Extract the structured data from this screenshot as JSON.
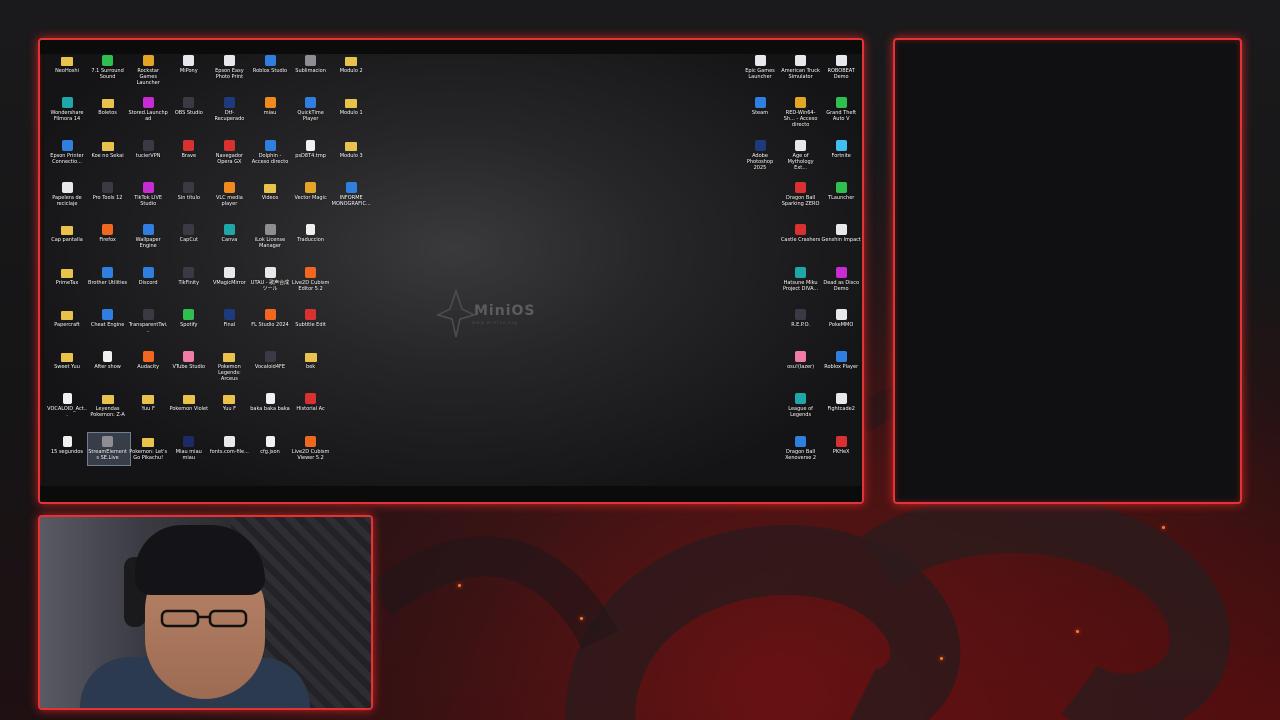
{
  "desktop": {
    "logo": {
      "name": "MiniOS",
      "tagline": "www.minios.org"
    },
    "left_icons": [
      {
        "label": "NeoHoshi",
        "kind": "folder",
        "col": 0,
        "row": 0
      },
      {
        "label": "7.1 Surround Sound",
        "kind": "app-green",
        "col": 1,
        "row": 0
      },
      {
        "label": "Rockstar Games Launcher",
        "kind": "app-yellow",
        "col": 2,
        "row": 0
      },
      {
        "label": "MiPony",
        "kind": "app-white",
        "col": 3,
        "row": 0
      },
      {
        "label": "Epson Easy Photo Print",
        "kind": "app-white",
        "col": 4,
        "row": 0
      },
      {
        "label": "Roblox Studio",
        "kind": "app-blue",
        "col": 5,
        "row": 0
      },
      {
        "label": "Sublimacion",
        "kind": "app-gray",
        "col": 6,
        "row": 0
      },
      {
        "label": "Modulo 2",
        "kind": "folder",
        "col": 7,
        "row": 0
      },
      {
        "label": "Wondershare Filmora 14",
        "kind": "app-teal",
        "col": 0,
        "row": 1
      },
      {
        "label": "Boletos",
        "kind": "folder",
        "col": 1,
        "row": 1
      },
      {
        "label": "Stored.Launchpad",
        "kind": "app-magenta",
        "col": 2,
        "row": 1
      },
      {
        "label": "OBS Studio",
        "kind": "app-dark",
        "col": 3,
        "row": 1
      },
      {
        "label": "Dtf- Recuperado",
        "kind": "app-ps",
        "col": 4,
        "row": 1
      },
      {
        "label": "miau",
        "kind": "app-vlc",
        "col": 5,
        "row": 1
      },
      {
        "label": "QuickTime Player",
        "kind": "app-blue",
        "col": 6,
        "row": 1
      },
      {
        "label": "Modulo 1",
        "kind": "folder",
        "col": 7,
        "row": 1
      },
      {
        "label": "Epson Printer Connectio...",
        "kind": "app-blue",
        "col": 0,
        "row": 2
      },
      {
        "label": "Koe no Sekai",
        "kind": "folder",
        "col": 1,
        "row": 2
      },
      {
        "label": "tucierVPN",
        "kind": "app-dark",
        "col": 2,
        "row": 2
      },
      {
        "label": "Brave",
        "kind": "app-red",
        "col": 3,
        "row": 2
      },
      {
        "label": "Navegador Opera GX",
        "kind": "app-red",
        "col": 4,
        "row": 2
      },
      {
        "label": "Dolphin - Acceso directo",
        "kind": "app-blue",
        "col": 5,
        "row": 2
      },
      {
        "label": "psD8T4.tmp",
        "kind": "file",
        "col": 6,
        "row": 2
      },
      {
        "label": "Modulo 3",
        "kind": "folder",
        "col": 7,
        "row": 2
      },
      {
        "label": "Papelera de reciclaje",
        "kind": "app-white",
        "col": 0,
        "row": 3
      },
      {
        "label": "Pro Tools 12",
        "kind": "app-dark",
        "col": 1,
        "row": 3
      },
      {
        "label": "TikTok LIVE Studio",
        "kind": "app-magenta",
        "col": 2,
        "row": 3
      },
      {
        "label": "Sin título",
        "kind": "app-dark",
        "col": 3,
        "row": 3
      },
      {
        "label": "VLC media player",
        "kind": "app-vlc",
        "col": 4,
        "row": 3
      },
      {
        "label": "Videos",
        "kind": "folder",
        "col": 5,
        "row": 3
      },
      {
        "label": "Vector Magic",
        "kind": "app-yellow",
        "col": 6,
        "row": 3
      },
      {
        "label": "INFORME MONOGRAFIC...",
        "kind": "app-blue",
        "col": 7,
        "row": 3
      },
      {
        "label": "Cap pantalla",
        "kind": "folder",
        "col": 0,
        "row": 4
      },
      {
        "label": "Firefox",
        "kind": "app-orange",
        "col": 1,
        "row": 4
      },
      {
        "label": "Wallpaper Engine",
        "kind": "app-blue",
        "col": 2,
        "row": 4
      },
      {
        "label": "CapCut",
        "kind": "app-dark",
        "col": 3,
        "row": 4
      },
      {
        "label": "Canva",
        "kind": "app-teal",
        "col": 4,
        "row": 4
      },
      {
        "label": "iLok License Manager",
        "kind": "app-gray",
        "col": 5,
        "row": 4
      },
      {
        "label": "Traduccion",
        "kind": "file",
        "col": 6,
        "row": 4
      },
      {
        "label": "PrimeTax",
        "kind": "folder",
        "col": 0,
        "row": 5
      },
      {
        "label": "Brother Utilities",
        "kind": "app-blue",
        "col": 1,
        "row": 5
      },
      {
        "label": "Discord",
        "kind": "app-blue",
        "col": 2,
        "row": 5
      },
      {
        "label": "TikFinity",
        "kind": "app-dark",
        "col": 3,
        "row": 5
      },
      {
        "label": "VMagicMirror",
        "kind": "app-white",
        "col": 4,
        "row": 5
      },
      {
        "label": "UTAU - 歌声合成ツール",
        "kind": "app-white",
        "col": 5,
        "row": 5
      },
      {
        "label": "Live2D Cubism Editor 5.2",
        "kind": "app-orange",
        "col": 6,
        "row": 5
      },
      {
        "label": "Papercraft",
        "kind": "folder",
        "col": 0,
        "row": 6
      },
      {
        "label": "Cheat Engine",
        "kind": "app-blue",
        "col": 1,
        "row": 6
      },
      {
        "label": "TransparentTwi...",
        "kind": "app-dark",
        "col": 2,
        "row": 6
      },
      {
        "label": "Spotify",
        "kind": "app-green",
        "col": 3,
        "row": 6
      },
      {
        "label": "Final",
        "kind": "app-ps",
        "col": 4,
        "row": 6
      },
      {
        "label": "FL Studio 2024",
        "kind": "app-orange",
        "col": 5,
        "row": 6
      },
      {
        "label": "Subtitle Edit",
        "kind": "app-red",
        "col": 6,
        "row": 6
      },
      {
        "label": "Sweet Yuu",
        "kind": "folder",
        "col": 0,
        "row": 7
      },
      {
        "label": "After show",
        "kind": "file",
        "col": 1,
        "row": 7
      },
      {
        "label": "Audacity",
        "kind": "app-orange",
        "col": 2,
        "row": 7
      },
      {
        "label": "VTube Studio",
        "kind": "app-pink",
        "col": 3,
        "row": 7
      },
      {
        "label": "Pokemon Legends: Arceus",
        "kind": "folder",
        "col": 4,
        "row": 7
      },
      {
        "label": "Vocaloid4FE",
        "kind": "app-dark",
        "col": 5,
        "row": 7
      },
      {
        "label": "bek",
        "kind": "folder",
        "col": 6,
        "row": 7
      },
      {
        "label": "VOCALOID_Act...",
        "kind": "file",
        "col": 0,
        "row": 8
      },
      {
        "label": "Leyendas Pokemon: Z-A",
        "kind": "folder",
        "col": 1,
        "row": 8
      },
      {
        "label": "Yuu F",
        "kind": "folder",
        "col": 2,
        "row": 8
      },
      {
        "label": "Pokemon Violet",
        "kind": "folder",
        "col": 3,
        "row": 8
      },
      {
        "label": "Yuu F",
        "kind": "folder",
        "col": 4,
        "row": 8
      },
      {
        "label": "baka baka baka",
        "kind": "file",
        "col": 5,
        "row": 8
      },
      {
        "label": "Historial Ac",
        "kind": "app-red",
        "col": 6,
        "row": 8
      },
      {
        "label": "15 segundos",
        "kind": "file",
        "col": 0,
        "row": 9
      },
      {
        "label": "StreamElements SE.Live",
        "kind": "app-gray",
        "col": 1,
        "row": 9,
        "selected": true
      },
      {
        "label": "Pokemon: Let's Go Pikachu!",
        "kind": "folder",
        "col": 2,
        "row": 9
      },
      {
        "label": "Miau miau miau",
        "kind": "app-navy",
        "col": 3,
        "row": 9
      },
      {
        "label": "fonts.com-file...",
        "kind": "app-white",
        "col": 4,
        "row": 9
      },
      {
        "label": "cfg.json",
        "kind": "file",
        "col": 5,
        "row": 9
      },
      {
        "label": "Live2D Cubism Viewer 5.2",
        "kind": "app-orange",
        "col": 6,
        "row": 9
      }
    ],
    "right_icons": [
      {
        "label": "Epic Games Launcher",
        "kind": "app-white",
        "col": 0,
        "row": 0
      },
      {
        "label": "American Truck Simulator",
        "kind": "app-white",
        "col": 1,
        "row": 0
      },
      {
        "label": "ROBOBEAT Demo",
        "kind": "app-white",
        "col": 2,
        "row": 0
      },
      {
        "label": "Steam",
        "kind": "app-blue",
        "col": 0,
        "row": 1
      },
      {
        "label": "RED-Win64-Sh... - Acceso directo",
        "kind": "app-yellow",
        "col": 1,
        "row": 1
      },
      {
        "label": "Grand Theft Auto V",
        "kind": "app-green",
        "col": 2,
        "row": 1
      },
      {
        "label": "Adobe Photoshop 2025",
        "kind": "app-ps",
        "col": 0,
        "row": 2
      },
      {
        "label": "Age of Mythology Ext...",
        "kind": "app-white",
        "col": 1,
        "row": 2
      },
      {
        "label": "Fortnite",
        "kind": "app-sky",
        "col": 2,
        "row": 2
      },
      {
        "label": "Dragon Ball Sparking ZERO",
        "kind": "app-red",
        "col": 1,
        "row": 3
      },
      {
        "label": "TLauncher",
        "kind": "app-green",
        "col": 2,
        "row": 3
      },
      {
        "label": "Castle Crashers",
        "kind": "app-red",
        "col": 1,
        "row": 4
      },
      {
        "label": "Genshin Impact",
        "kind": "app-white",
        "col": 2,
        "row": 4
      },
      {
        "label": "Hatsune Miku Project DIVA...",
        "kind": "app-teal",
        "col": 1,
        "row": 5
      },
      {
        "label": "Dead as Disco Demo",
        "kind": "app-magenta",
        "col": 2,
        "row": 5
      },
      {
        "label": "R.E.P.O.",
        "kind": "app-dark",
        "col": 1,
        "row": 6
      },
      {
        "label": "PokeMMO",
        "kind": "app-white",
        "col": 2,
        "row": 6
      },
      {
        "label": "osu!(lazer)",
        "kind": "app-pink",
        "col": 1,
        "row": 7
      },
      {
        "label": "Roblox Player",
        "kind": "app-blue",
        "col": 2,
        "row": 7
      },
      {
        "label": "League of Legends",
        "kind": "app-teal",
        "col": 1,
        "row": 8
      },
      {
        "label": "Fightcade2",
        "kind": "app-white",
        "col": 2,
        "row": 8
      },
      {
        "label": "Dragon Ball Xenoverse 2",
        "kind": "app-blue",
        "col": 1,
        "row": 9
      },
      {
        "label": "PKHeX",
        "kind": "app-red",
        "col": 2,
        "row": 9
      }
    ]
  },
  "colors": {
    "frame": "#e23434",
    "folder": "#e8c24a",
    "app-green": "#2fbf4f",
    "app-yellow": "#e2a526",
    "app-white": "#e8e8ec",
    "app-blue": "#2f7fe0",
    "app-gray": "#8d8d93",
    "app-teal": "#1fa6a8",
    "app-magenta": "#c72bd1",
    "app-dark": "#3a3a44",
    "app-ps": "#1e3a7a",
    "app-vlc": "#f08a1c",
    "app-red": "#d93131",
    "app-orange": "#f2671f",
    "app-pink": "#f07aa8",
    "app-navy": "#1c2a66",
    "app-sky": "#3ec1f2",
    "file": "#f0f0f0"
  }
}
